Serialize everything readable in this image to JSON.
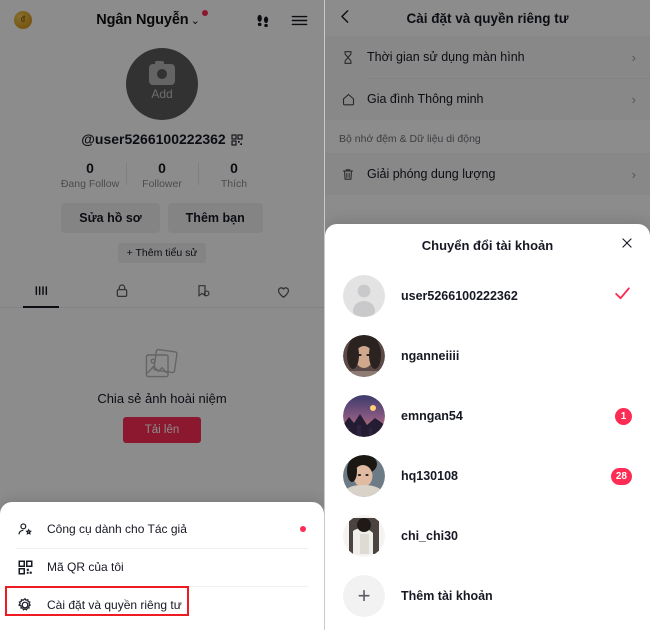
{
  "left": {
    "header": {
      "coin_icon": "coin-icon",
      "username": "Ngân Nguyễn",
      "chevron": "⌄",
      "footprints_icon": "footprints-icon",
      "menu_icon": "hamburger-icon"
    },
    "profile": {
      "avatar_label": "Add",
      "handle": "@user5266100222362",
      "qr_icon": "qr-code-icon"
    },
    "stats": [
      {
        "value": "0",
        "label": "Đang Follow"
      },
      {
        "value": "0",
        "label": "Follower"
      },
      {
        "value": "0",
        "label": "Thích"
      }
    ],
    "actions": {
      "edit_profile": "Sửa hồ sơ",
      "add_friend": "Thêm bạn",
      "add_bio": "+ Thêm tiểu sử"
    },
    "tabs": [
      {
        "name": "posts-tab",
        "icon": "grid-icon",
        "active": true
      },
      {
        "name": "private-tab",
        "icon": "lock-icon",
        "active": false
      },
      {
        "name": "reposts-tab",
        "icon": "repost-icon",
        "active": false
      },
      {
        "name": "liked-tab",
        "icon": "heart-icon",
        "active": false
      }
    ],
    "empty": {
      "icon": "photo-stack-icon",
      "text": "Chia sẻ ảnh hoài niệm",
      "upload_label": "Tải lên"
    },
    "menu": [
      {
        "icon": "creator-tools-icon",
        "label": "Công cụ dành cho Tác giả",
        "dot": true
      },
      {
        "icon": "qr-code-icon",
        "label": "Mã QR của tôi",
        "dot": false
      },
      {
        "icon": "gear-icon",
        "label": "Cài đặt và quyền riêng tư",
        "dot": false
      }
    ]
  },
  "right": {
    "header": {
      "back_icon": "chevron-left-icon",
      "title": "Cài đặt và quyền riêng tư"
    },
    "rows_top": [
      {
        "icon": "hourglass-icon",
        "label": "Thời gian sử dụng màn hình",
        "chevron": "›"
      },
      {
        "icon": "home-icon",
        "label": "Gia đình Thông minh",
        "chevron": "›"
      }
    ],
    "section_label": "Bộ nhớ đệm & Dữ liệu di động",
    "rows_storage": [
      {
        "icon": "trash-icon",
        "label": "Giải phóng dung lượng",
        "chevron": "›"
      }
    ],
    "account_sheet": {
      "title": "Chuyển đổi tài khoản",
      "close_icon": "close-icon",
      "accounts": [
        {
          "name": "user5266100222362",
          "avatar": "default",
          "selected": true,
          "badge": null
        },
        {
          "name": "nganneiiii",
          "avatar": "photo-girl",
          "selected": false,
          "badge": null
        },
        {
          "name": "emngan54",
          "avatar": "photo-city",
          "selected": false,
          "badge": "1"
        },
        {
          "name": "hq130108",
          "avatar": "photo-boy",
          "selected": false,
          "badge": "28"
        },
        {
          "name": "chi_chi30",
          "avatar": "photo-person",
          "selected": false,
          "badge": null
        }
      ],
      "add_account": {
        "icon": "plus-icon",
        "label": "Thêm tài khoản"
      }
    }
  },
  "colors": {
    "accent": "#fe2c55",
    "highlight_box": "#ee1b23",
    "text": "#161823",
    "muted": "#8a8b91"
  }
}
